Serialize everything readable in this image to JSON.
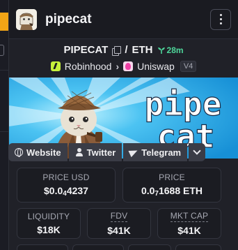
{
  "token": {
    "name": "pipecat",
    "symbol": "PIPECAT",
    "quote": "ETH",
    "pair_separator": "/",
    "age": "28m"
  },
  "route": {
    "from": "Robinhood",
    "to": "Uniswap",
    "version": "V4"
  },
  "banner": {
    "word1": "pipe",
    "word2": "cat"
  },
  "socials": [
    {
      "label": "Website",
      "icon": "globe-icon"
    },
    {
      "label": "Twitter",
      "icon": "person-icon"
    },
    {
      "label": "Telegram",
      "icon": "telegram-icon"
    }
  ],
  "stats": {
    "price_usd": {
      "label": "PRICE USD",
      "prefix": "$0.0",
      "sub": "4",
      "rest": "4237"
    },
    "price_eth": {
      "label": "PRICE",
      "prefix": "0.0",
      "sub": "7",
      "rest": "1688 ETH"
    },
    "liquidity": {
      "label": "LIQUIDITY",
      "value": "$18K"
    },
    "fdv": {
      "label": "FDV",
      "value": "$41K"
    },
    "mkt_cap": {
      "label": "MKT CAP",
      "value": "$41K"
    }
  },
  "colors": {
    "age_green": "#4ed69a",
    "backdrop_accent": "#f2a516",
    "banner_sky": "#27a8e6"
  }
}
